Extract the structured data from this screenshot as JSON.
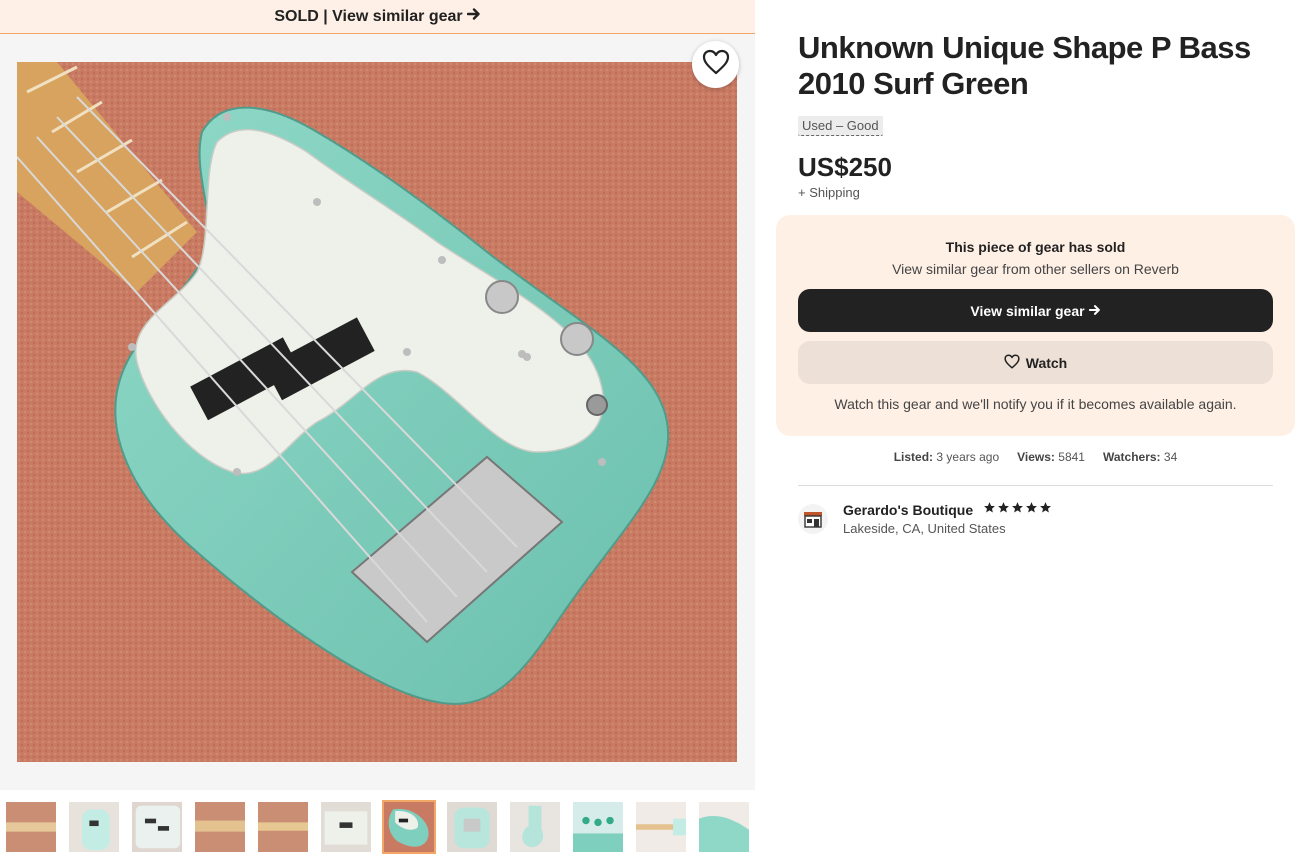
{
  "banner": {
    "sold_text": "SOLD | View similar gear",
    "arrow": "→"
  },
  "gallery": {
    "favorite_icon": "heart-icon",
    "thumbnail_count": 12,
    "active_thumbnail": 7
  },
  "listing": {
    "title": "Unknown Unique Shape P Bass 2010 Surf Green",
    "condition": "Used – Good",
    "price": "US$250",
    "shipping": "+ Shipping"
  },
  "sold_card": {
    "heading": "This piece of gear has sold",
    "subheading": "View similar gear from other sellers on Reverb",
    "similar_button": "View similar gear",
    "watch_button": "Watch",
    "watch_note": "Watch this gear and we'll notify you if it becomes available again."
  },
  "stats": {
    "listed_label": "Listed:",
    "listed_value": "3 years ago",
    "views_label": "Views:",
    "views_value": "5841",
    "watchers_label": "Watchers:",
    "watchers_value": "34"
  },
  "seller": {
    "name": "Gerardo's Boutique",
    "location": "Lakeside, CA, United States",
    "rating_stars": 5
  },
  "colors": {
    "banner_bg": "#fef0e6",
    "accent_orange": "#f2a766",
    "card_bg": "#fff0e6",
    "dark_button": "#222222",
    "watch_button": "#ede0d6",
    "guitar_body": "#7fcfbf"
  }
}
